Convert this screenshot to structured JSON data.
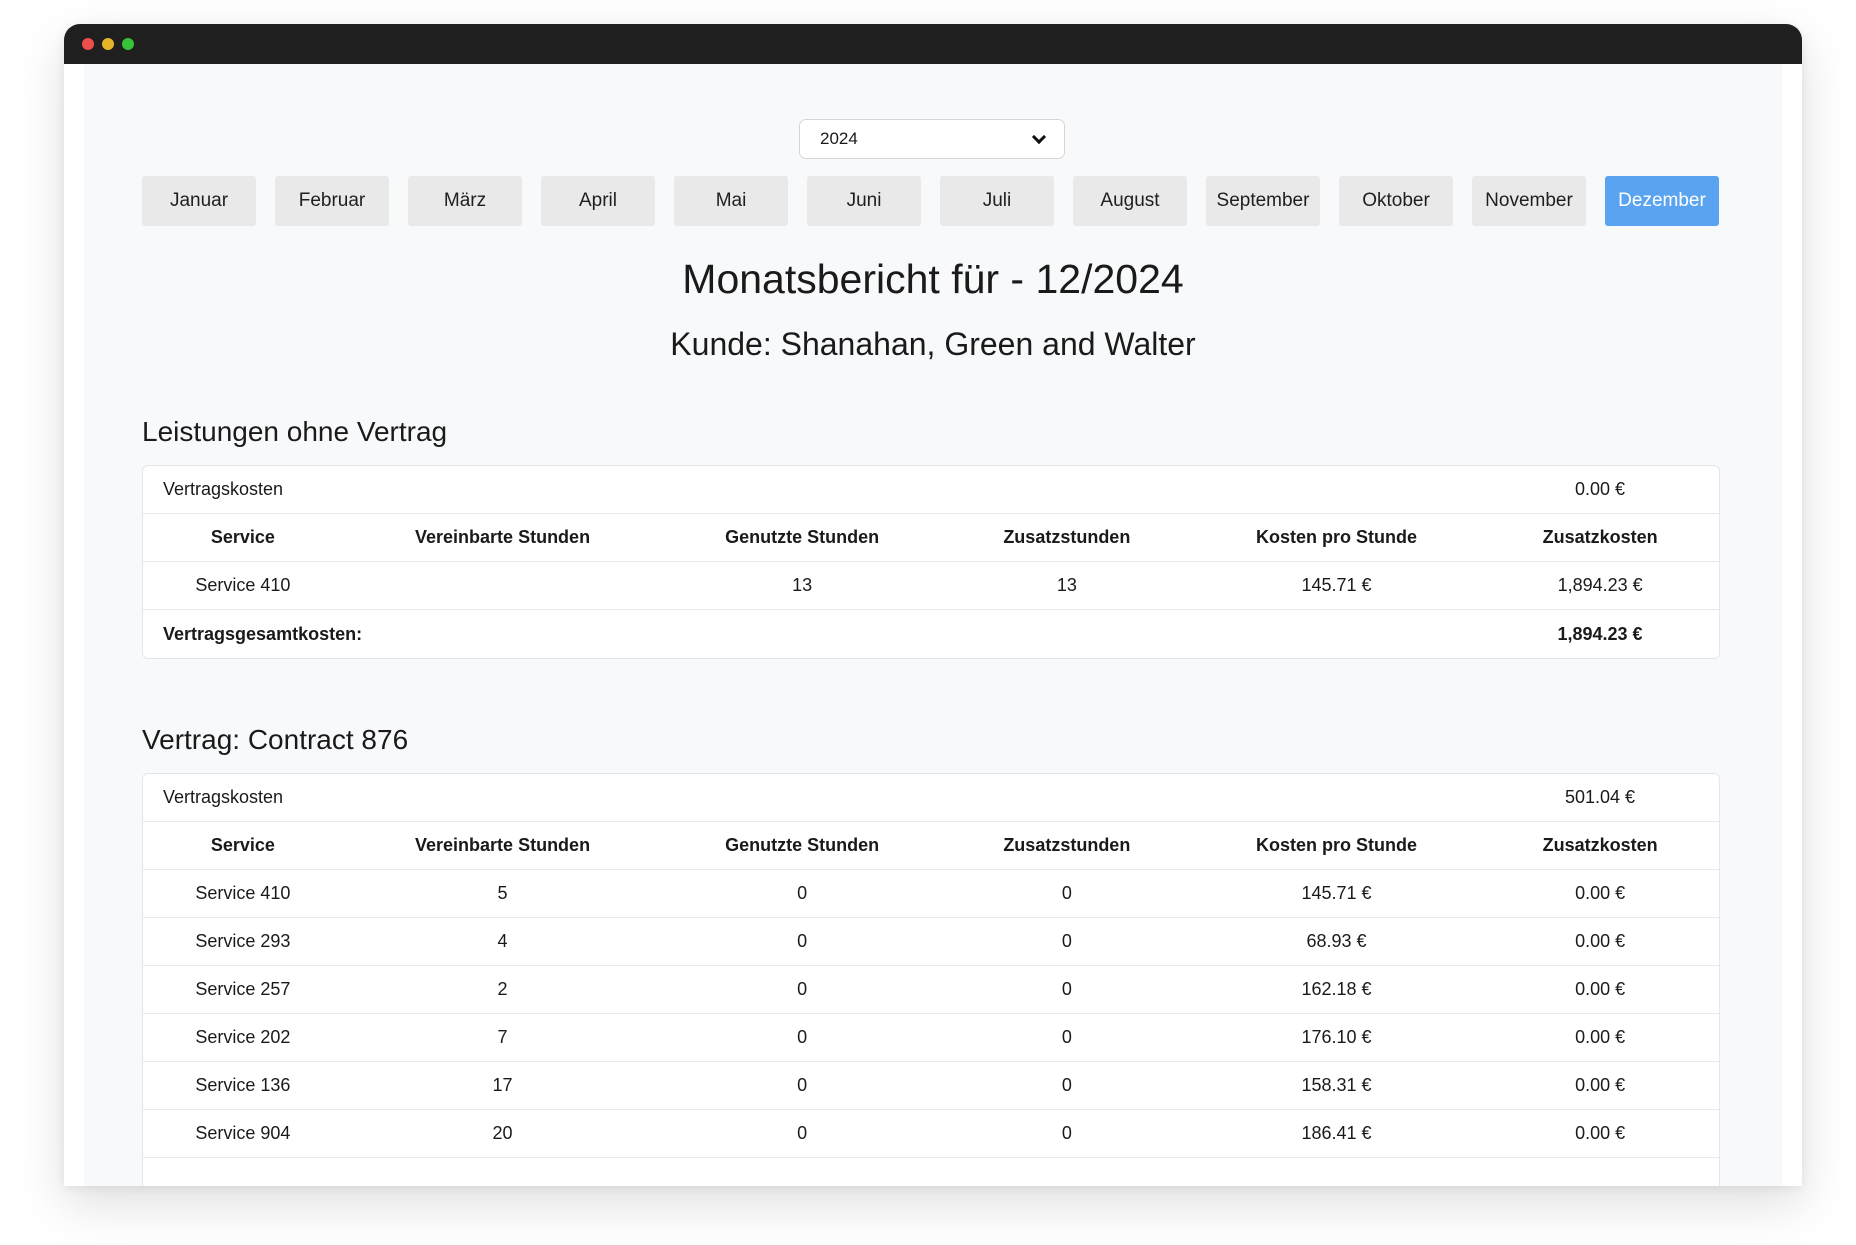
{
  "year_select": {
    "value": "2024"
  },
  "months": [
    {
      "label": "Januar",
      "active": false
    },
    {
      "label": "Februar",
      "active": false
    },
    {
      "label": "März",
      "active": false
    },
    {
      "label": "April",
      "active": false
    },
    {
      "label": "Mai",
      "active": false
    },
    {
      "label": "Juni",
      "active": false
    },
    {
      "label": "Juli",
      "active": false
    },
    {
      "label": "August",
      "active": false
    },
    {
      "label": "September",
      "active": false
    },
    {
      "label": "Oktober",
      "active": false
    },
    {
      "label": "November",
      "active": false
    },
    {
      "label": "Dezember",
      "active": true
    }
  ],
  "report": {
    "title": "Monatsbericht für - 12/2024",
    "customer": "Kunde: Shanahan, Green and Walter"
  },
  "columns": [
    "Service",
    "Vereinbarte Stunden",
    "Genutzte Stunden",
    "Zusatzstunden",
    "Kosten pro Stunde",
    "Zusatzkosten"
  ],
  "section1": {
    "title": "Leistungen ohne Vertrag",
    "cost_label": "Vertragskosten",
    "cost_value": "0.00 €",
    "rows": [
      {
        "service": "Service 410",
        "agreed": "",
        "used": "13",
        "extra": "13",
        "rate": "145.71 €",
        "extra_cost": "1,894.23 €"
      }
    ],
    "total_label": "Vertragsgesamtkosten:",
    "total_value": "1,894.23 €"
  },
  "section2": {
    "title": "Vertrag: Contract 876",
    "cost_label": "Vertragskosten",
    "cost_value": "501.04 €",
    "rows": [
      {
        "service": "Service 410",
        "agreed": "5",
        "used": "0",
        "extra": "0",
        "rate": "145.71 €",
        "extra_cost": "0.00 €"
      },
      {
        "service": "Service 293",
        "agreed": "4",
        "used": "0",
        "extra": "0",
        "rate": "68.93 €",
        "extra_cost": "0.00 €"
      },
      {
        "service": "Service 257",
        "agreed": "2",
        "used": "0",
        "extra": "0",
        "rate": "162.18 €",
        "extra_cost": "0.00 €"
      },
      {
        "service": "Service 202",
        "agreed": "7",
        "used": "0",
        "extra": "0",
        "rate": "176.10 €",
        "extra_cost": "0.00 €"
      },
      {
        "service": "Service 136",
        "agreed": "17",
        "used": "0",
        "extra": "0",
        "rate": "158.31 €",
        "extra_cost": "0.00 €"
      },
      {
        "service": "Service 904",
        "agreed": "20",
        "used": "0",
        "extra": "0",
        "rate": "186.41 €",
        "extra_cost": "0.00 €"
      }
    ]
  }
}
